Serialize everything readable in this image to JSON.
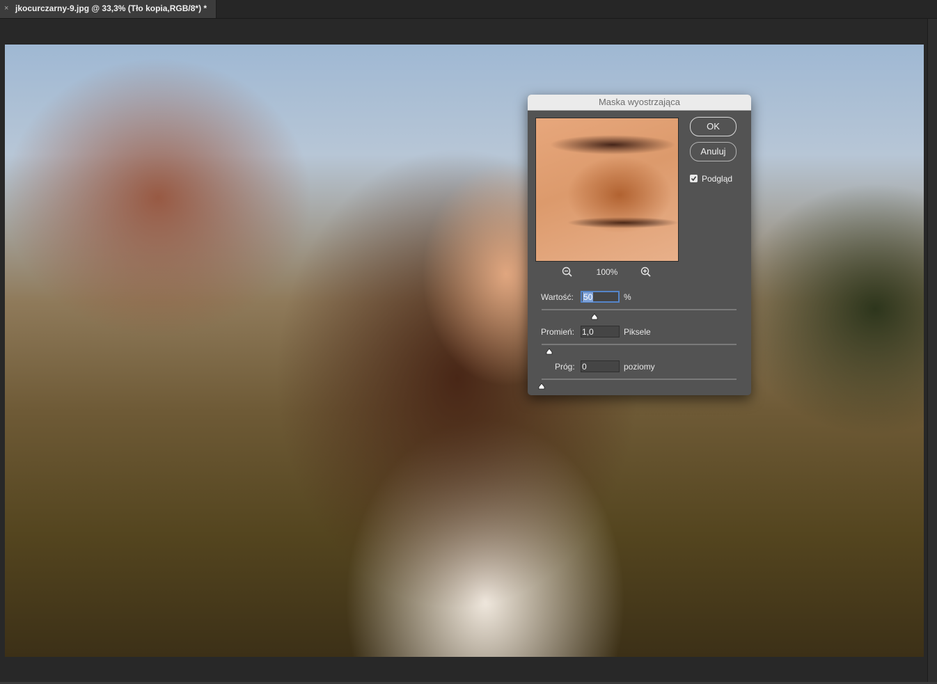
{
  "document_tab": {
    "close_glyph": "×",
    "title": "jkocurczarny-9.jpg @ 33,3% (Tło kopia,RGB/8*) *"
  },
  "dialog": {
    "title": "Maska wyostrzająca",
    "ok_label": "OK",
    "cancel_label": "Anuluj",
    "preview_label": "Podgląd",
    "preview_checked": true,
    "zoom_level": "100%",
    "amount": {
      "label": "Wartość:",
      "value": "50",
      "unit": "%",
      "slider_fraction": 0.27
    },
    "radius": {
      "label": "Promień:",
      "value": "1,0",
      "unit": "Piksele",
      "slider_fraction": 0.04
    },
    "threshold": {
      "label": "Próg:",
      "value": "0",
      "unit": "poziomy",
      "slider_fraction": 0.0
    }
  },
  "colors": {
    "dialog_bg": "#535353",
    "title_bar": "#ebebeb",
    "focus_ring": "#5585c9",
    "canvas_bg": "#282828"
  },
  "icons": [
    "close-icon",
    "zoom-out-icon",
    "zoom-in-icon",
    "checkmark-icon",
    "slider-thumb-icon"
  ]
}
